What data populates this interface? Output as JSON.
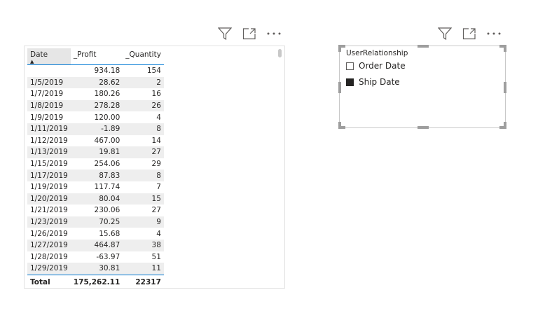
{
  "table": {
    "headers": [
      "Date",
      "_Profit",
      "_Quantity"
    ],
    "sort_icon": "sort-ascending-icon",
    "rows": [
      [
        "",
        "934.18",
        "154"
      ],
      [
        "1/5/2019",
        "28.62",
        "2"
      ],
      [
        "1/7/2019",
        "180.26",
        "16"
      ],
      [
        "1/8/2019",
        "278.28",
        "26"
      ],
      [
        "1/9/2019",
        "120.00",
        "4"
      ],
      [
        "1/11/2019",
        "-1.89",
        "8"
      ],
      [
        "1/12/2019",
        "467.00",
        "14"
      ],
      [
        "1/13/2019",
        "19.81",
        "27"
      ],
      [
        "1/15/2019",
        "254.06",
        "29"
      ],
      [
        "1/17/2019",
        "87.83",
        "8"
      ],
      [
        "1/19/2019",
        "117.74",
        "7"
      ],
      [
        "1/20/2019",
        "80.04",
        "15"
      ],
      [
        "1/21/2019",
        "230.06",
        "27"
      ],
      [
        "1/23/2019",
        "70.25",
        "9"
      ],
      [
        "1/26/2019",
        "15.68",
        "4"
      ],
      [
        "1/27/2019",
        "464.87",
        "38"
      ],
      [
        "1/28/2019",
        "-63.97",
        "51"
      ],
      [
        "1/29/2019",
        "30.81",
        "11"
      ]
    ],
    "total": [
      "Total",
      "175,262.11",
      "22317"
    ]
  },
  "slicer": {
    "title": "UserRelationship",
    "items": [
      {
        "label": "Order Date",
        "checked": false
      },
      {
        "label": "Ship Date",
        "checked": true
      }
    ]
  },
  "toolbar_icons": [
    "filter-icon",
    "focus-mode-icon",
    "more-options-icon"
  ],
  "colors": {
    "accent": "#0078d4",
    "stripe": "#eeeeee",
    "checked": "#252423"
  }
}
